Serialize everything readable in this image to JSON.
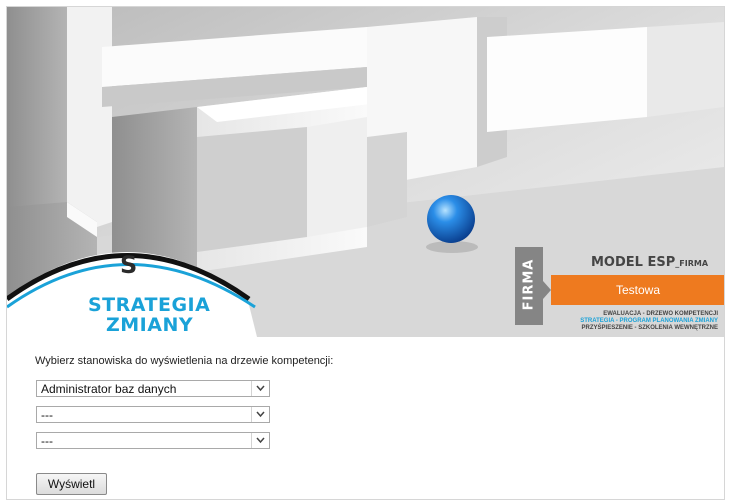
{
  "header": {
    "logo": {
      "letter": "S",
      "line1": "STRATEGIA",
      "line2": "ZMIANY"
    },
    "badge": {
      "vertical_label": "FIRMA",
      "title_main": "MODEL ESP",
      "title_suffix": "_FIRMA",
      "company": "Testowa",
      "line1": "EWALUACJA - DRZEWO KOMPETENCJI",
      "line2": "STRATEGIA - PROGRAM PLANOWANIA ZMIANY",
      "line3": "PRZYŚPIESZENIE - SZKOLENIA WEWNĘTRZNE"
    },
    "colors": {
      "accent_blue": "#1aa2d8",
      "accent_orange": "#ee7a1f",
      "badge_gray": "#858585"
    }
  },
  "form": {
    "prompt": "Wybierz stanowiska do wyświetlenia na drzewie kompetencji:",
    "selects": [
      {
        "value": "Administrator baz danych"
      },
      {
        "value": "---"
      },
      {
        "value": "---"
      }
    ],
    "submit_label": "Wyświetl"
  }
}
